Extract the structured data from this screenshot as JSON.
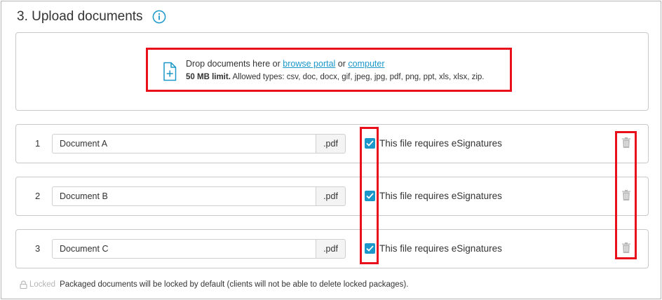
{
  "section": {
    "title": "3. Upload documents",
    "info_icon": "info-icon"
  },
  "dropzone": {
    "prefix": "Drop documents here or ",
    "browse_link": "browse portal",
    "or_text": " or ",
    "computer_link": "computer",
    "limit": "50 MB limit.",
    "allowed_types": " Allowed types: csv, doc, docx, gif, jpeg, jpg, pdf, png, ppt, xls, xlsx, zip.",
    "icon": "file-plus-icon"
  },
  "documents": [
    {
      "number": "1",
      "name": "Document A",
      "extension": ".pdf",
      "esign_label": "This file requires eSignatures",
      "esign_checked": true
    },
    {
      "number": "2",
      "name": "Document B",
      "extension": ".pdf",
      "esign_label": "This file requires eSignatures",
      "esign_checked": true
    },
    {
      "number": "3",
      "name": "Document C",
      "extension": ".pdf",
      "esign_label": "This file requires eSignatures",
      "esign_checked": true
    }
  ],
  "footer": {
    "locked_label": "Locked",
    "note": "Packaged documents will be locked by default (clients will not be able to delete locked packages)."
  },
  "colors": {
    "accent": "#1b97c9",
    "highlight": "#e8101a",
    "border": "#c9c9c9"
  }
}
